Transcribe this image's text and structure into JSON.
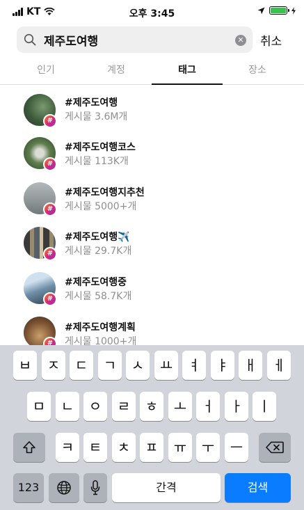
{
  "status_bar": {
    "carrier": "KT",
    "time": "오후 3:45",
    "battery_level": 1.0
  },
  "search": {
    "query": "제주도여행",
    "cancel_label": "취소"
  },
  "tabs": [
    {
      "label": "인기",
      "active": false
    },
    {
      "label": "계정",
      "active": false
    },
    {
      "label": "태그",
      "active": true
    },
    {
      "label": "장소",
      "active": false
    }
  ],
  "results": [
    {
      "tag": "#제주도여행",
      "posts": "게시물 3.6M개"
    },
    {
      "tag": "#제주도여행코스",
      "posts": "게시물 113K개"
    },
    {
      "tag": "#제주도여행지추천",
      "posts": "게시물 5000+개"
    },
    {
      "tag": "#제주도여행✈️",
      "posts": "게시물 29.7K개"
    },
    {
      "tag": "#제주도여행중",
      "posts": "게시물 58.7K개"
    },
    {
      "tag": "#제주도여행계획",
      "posts": "게시물 1000+개"
    }
  ],
  "keyboard": {
    "row1": [
      "ㅂ",
      "ㅈ",
      "ㄷ",
      "ㄱ",
      "ㅅ",
      "ㅛ",
      "ㅕ",
      "ㅑ",
      "ㅐ",
      "ㅔ"
    ],
    "row2": [
      "ㅁ",
      "ㄴ",
      "ㅇ",
      "ㄹ",
      "ㅎ",
      "ㅗ",
      "ㅓ",
      "ㅏ",
      "ㅣ"
    ],
    "row3": [
      "ㅋ",
      "ㅌ",
      "ㅊ",
      "ㅍ",
      "ㅠ",
      "ㅜ",
      "ㅡ"
    ],
    "numbers_label": "123",
    "space_label": "간격",
    "search_label": "검색"
  },
  "icons": [
    "signal-icon",
    "wifi-icon",
    "location-arrow-icon",
    "battery-icon",
    "charging-icon",
    "search-icon",
    "clear-icon",
    "hashtag-icon",
    "shift-icon",
    "backspace-icon",
    "globe-icon",
    "microphone-icon"
  ],
  "colors": {
    "accent_blue": "#0a7cff",
    "battery_green": "#37c44d",
    "keyboard_bg": "#d1d4da"
  }
}
